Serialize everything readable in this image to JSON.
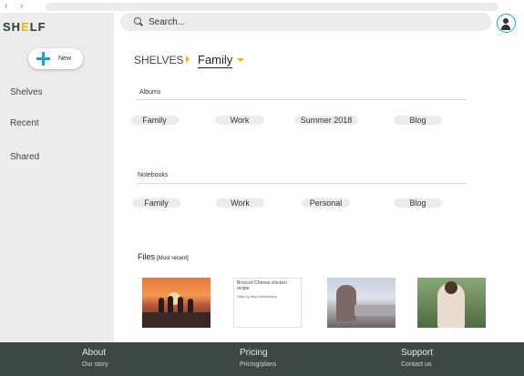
{
  "browser": {
    "back_icon": "chevron-left",
    "forward_icon": "chevron-right"
  },
  "logo": {
    "text_main": "SH",
    "text_accent": "E",
    "text_end": "LF"
  },
  "sidebar": {
    "new_button": "New",
    "items": [
      {
        "label": "Shelves"
      },
      {
        "label": "Recent"
      },
      {
        "label": "Shared"
      }
    ]
  },
  "search": {
    "placeholder": "Search..."
  },
  "breadcrumb": {
    "root": "SHELVES",
    "current": "Family"
  },
  "albums": {
    "label": "Albums",
    "items": [
      "Family",
      "Work",
      "Summer 2018",
      "Blog"
    ]
  },
  "notebooks": {
    "label": "Notebooks",
    "items": [
      "Family",
      "Work",
      "Personal",
      "Blog"
    ]
  },
  "files": {
    "title": "Files",
    "sort": "[Most recent]",
    "note": {
      "title": "Broccoli Cheese chicken recipe",
      "subtitle": "Step by step instructions"
    }
  },
  "footer": {
    "columns": [
      {
        "heading": "About",
        "link": "Our story"
      },
      {
        "heading": "Pricing",
        "link": "Pricing/plans"
      },
      {
        "heading": "Support",
        "link": "Contact us"
      }
    ]
  },
  "colors": {
    "accent": "#1aa5c7",
    "highlight": "#f4b400",
    "footer": "#3d4844",
    "sidebar": "#ececec"
  }
}
